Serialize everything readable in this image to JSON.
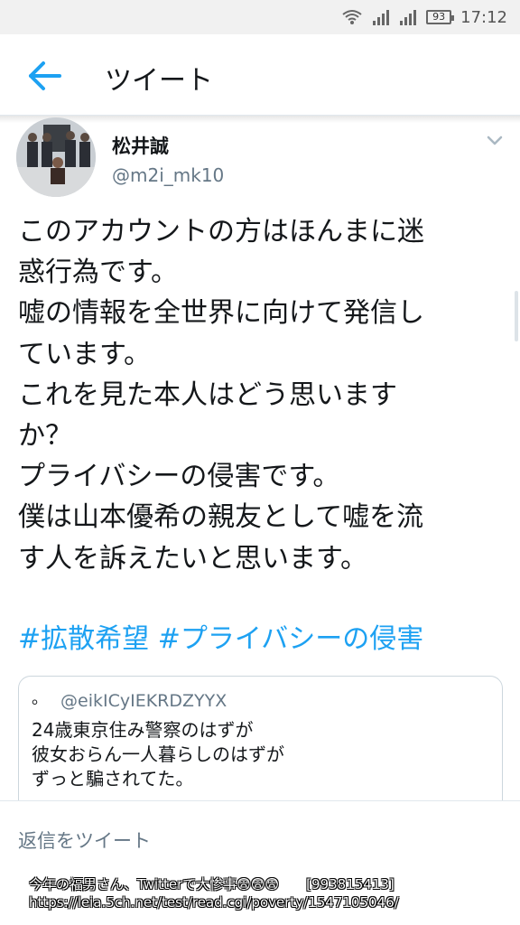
{
  "status_bar": {
    "battery": "93",
    "time": "17:12"
  },
  "header": {
    "title": "ツイート"
  },
  "tweet": {
    "name": "松井誠",
    "handle": "@m2i_mk10",
    "lines": [
      "このアカウントの方はほんまに迷",
      "惑行為です。",
      "嘘の情報を全世界に向けて発信し",
      "ています。",
      "これを見た本人はどう思います",
      "か？",
      "プライバシーの侵害です。",
      "僕は山本優希の親友として嘘を流",
      "す人を訴えたいと思います。"
    ],
    "hashtags": [
      "#拡散希望",
      "#プライバシーの侵害"
    ]
  },
  "quote": {
    "avatar_glyph": "。",
    "handle": "@eikICyIEKRDZYYX",
    "lines": [
      "24歳東京住み警察のはずが",
      "彼女おらん一人暮らしのはずが",
      "ずっと騙されてた。"
    ]
  },
  "reply": {
    "placeholder": "返信をツイート"
  },
  "caption": {
    "line1": "今年の福男さん、Twitterで大惨事😨😨😨　　[993815413]",
    "line2": "https://leia.5ch.net/test/read.cgi/poverty/1547105046/"
  },
  "colors": {
    "accent": "#1da1f2",
    "secondary_text": "#657786",
    "border": "#e1e8ed"
  }
}
